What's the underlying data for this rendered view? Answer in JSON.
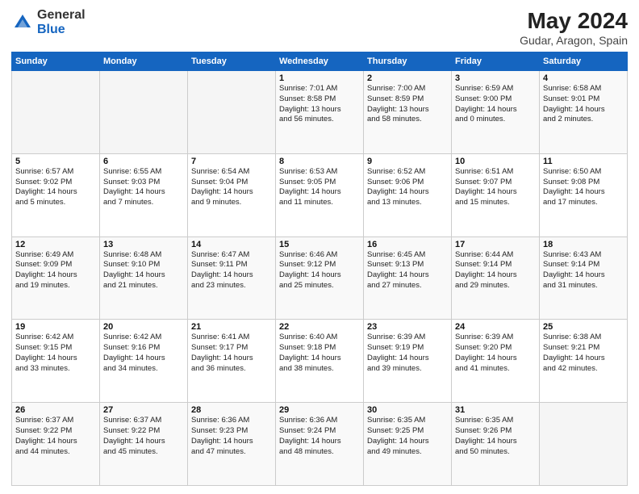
{
  "header": {
    "logo_general": "General",
    "logo_blue": "Blue",
    "title": "May 2024",
    "subtitle": "Gudar, Aragon, Spain"
  },
  "weekdays": [
    "Sunday",
    "Monday",
    "Tuesday",
    "Wednesday",
    "Thursday",
    "Friday",
    "Saturday"
  ],
  "weeks": [
    [
      {
        "day": "",
        "info": ""
      },
      {
        "day": "",
        "info": ""
      },
      {
        "day": "",
        "info": ""
      },
      {
        "day": "1",
        "info": "Sunrise: 7:01 AM\nSunset: 8:58 PM\nDaylight: 13 hours\nand 56 minutes."
      },
      {
        "day": "2",
        "info": "Sunrise: 7:00 AM\nSunset: 8:59 PM\nDaylight: 13 hours\nand 58 minutes."
      },
      {
        "day": "3",
        "info": "Sunrise: 6:59 AM\nSunset: 9:00 PM\nDaylight: 14 hours\nand 0 minutes."
      },
      {
        "day": "4",
        "info": "Sunrise: 6:58 AM\nSunset: 9:01 PM\nDaylight: 14 hours\nand 2 minutes."
      }
    ],
    [
      {
        "day": "5",
        "info": "Sunrise: 6:57 AM\nSunset: 9:02 PM\nDaylight: 14 hours\nand 5 minutes."
      },
      {
        "day": "6",
        "info": "Sunrise: 6:55 AM\nSunset: 9:03 PM\nDaylight: 14 hours\nand 7 minutes."
      },
      {
        "day": "7",
        "info": "Sunrise: 6:54 AM\nSunset: 9:04 PM\nDaylight: 14 hours\nand 9 minutes."
      },
      {
        "day": "8",
        "info": "Sunrise: 6:53 AM\nSunset: 9:05 PM\nDaylight: 14 hours\nand 11 minutes."
      },
      {
        "day": "9",
        "info": "Sunrise: 6:52 AM\nSunset: 9:06 PM\nDaylight: 14 hours\nand 13 minutes."
      },
      {
        "day": "10",
        "info": "Sunrise: 6:51 AM\nSunset: 9:07 PM\nDaylight: 14 hours\nand 15 minutes."
      },
      {
        "day": "11",
        "info": "Sunrise: 6:50 AM\nSunset: 9:08 PM\nDaylight: 14 hours\nand 17 minutes."
      }
    ],
    [
      {
        "day": "12",
        "info": "Sunrise: 6:49 AM\nSunset: 9:09 PM\nDaylight: 14 hours\nand 19 minutes."
      },
      {
        "day": "13",
        "info": "Sunrise: 6:48 AM\nSunset: 9:10 PM\nDaylight: 14 hours\nand 21 minutes."
      },
      {
        "day": "14",
        "info": "Sunrise: 6:47 AM\nSunset: 9:11 PM\nDaylight: 14 hours\nand 23 minutes."
      },
      {
        "day": "15",
        "info": "Sunrise: 6:46 AM\nSunset: 9:12 PM\nDaylight: 14 hours\nand 25 minutes."
      },
      {
        "day": "16",
        "info": "Sunrise: 6:45 AM\nSunset: 9:13 PM\nDaylight: 14 hours\nand 27 minutes."
      },
      {
        "day": "17",
        "info": "Sunrise: 6:44 AM\nSunset: 9:14 PM\nDaylight: 14 hours\nand 29 minutes."
      },
      {
        "day": "18",
        "info": "Sunrise: 6:43 AM\nSunset: 9:14 PM\nDaylight: 14 hours\nand 31 minutes."
      }
    ],
    [
      {
        "day": "19",
        "info": "Sunrise: 6:42 AM\nSunset: 9:15 PM\nDaylight: 14 hours\nand 33 minutes."
      },
      {
        "day": "20",
        "info": "Sunrise: 6:42 AM\nSunset: 9:16 PM\nDaylight: 14 hours\nand 34 minutes."
      },
      {
        "day": "21",
        "info": "Sunrise: 6:41 AM\nSunset: 9:17 PM\nDaylight: 14 hours\nand 36 minutes."
      },
      {
        "day": "22",
        "info": "Sunrise: 6:40 AM\nSunset: 9:18 PM\nDaylight: 14 hours\nand 38 minutes."
      },
      {
        "day": "23",
        "info": "Sunrise: 6:39 AM\nSunset: 9:19 PM\nDaylight: 14 hours\nand 39 minutes."
      },
      {
        "day": "24",
        "info": "Sunrise: 6:39 AM\nSunset: 9:20 PM\nDaylight: 14 hours\nand 41 minutes."
      },
      {
        "day": "25",
        "info": "Sunrise: 6:38 AM\nSunset: 9:21 PM\nDaylight: 14 hours\nand 42 minutes."
      }
    ],
    [
      {
        "day": "26",
        "info": "Sunrise: 6:37 AM\nSunset: 9:22 PM\nDaylight: 14 hours\nand 44 minutes."
      },
      {
        "day": "27",
        "info": "Sunrise: 6:37 AM\nSunset: 9:22 PM\nDaylight: 14 hours\nand 45 minutes."
      },
      {
        "day": "28",
        "info": "Sunrise: 6:36 AM\nSunset: 9:23 PM\nDaylight: 14 hours\nand 47 minutes."
      },
      {
        "day": "29",
        "info": "Sunrise: 6:36 AM\nSunset: 9:24 PM\nDaylight: 14 hours\nand 48 minutes."
      },
      {
        "day": "30",
        "info": "Sunrise: 6:35 AM\nSunset: 9:25 PM\nDaylight: 14 hours\nand 49 minutes."
      },
      {
        "day": "31",
        "info": "Sunrise: 6:35 AM\nSunset: 9:26 PM\nDaylight: 14 hours\nand 50 minutes."
      },
      {
        "day": "",
        "info": ""
      }
    ]
  ]
}
